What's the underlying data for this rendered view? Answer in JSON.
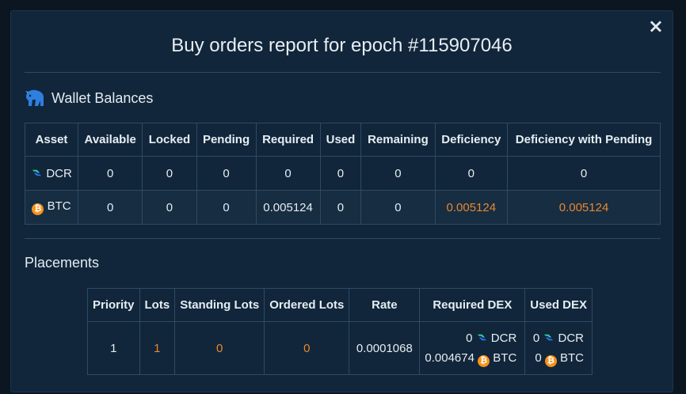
{
  "modal": {
    "title": "Buy orders report for epoch #115907046",
    "close_glyph": "×"
  },
  "wallet_balances": {
    "heading": "Wallet Balances",
    "icon": "dex-bull-logo-icon",
    "columns": [
      "Asset",
      "Available",
      "Locked",
      "Pending",
      "Required",
      "Used",
      "Remaining",
      "Deficiency",
      "Deficiency with Pending"
    ],
    "rows": [
      {
        "asset": "DCR",
        "icon": "dcr-icon",
        "available": "0",
        "locked": "0",
        "pending": "0",
        "required": "0",
        "used": "0",
        "remaining": "0",
        "deficiency": "0",
        "deficiency_pending": "0"
      },
      {
        "asset": "BTC",
        "icon": "btc-icon",
        "available": "0",
        "locked": "0",
        "pending": "0",
        "required": "0.005124",
        "used": "0",
        "remaining": "0",
        "deficiency": "0.005124",
        "deficiency_pending": "0.005124"
      }
    ]
  },
  "placements": {
    "heading": "Placements",
    "columns": [
      "Priority",
      "Lots",
      "Standing Lots",
      "Ordered Lots",
      "Rate",
      "Required DEX",
      "Used DEX"
    ],
    "rows": [
      {
        "priority": "1",
        "lots": "1",
        "standing_lots": "0",
        "ordered_lots": "0",
        "rate": "0.0001068",
        "required_dex": [
          {
            "amount": "0",
            "asset": "DCR"
          },
          {
            "amount": "0.004674",
            "asset": "BTC"
          }
        ],
        "used_dex": [
          {
            "amount": "0",
            "asset": "DCR"
          },
          {
            "amount": "0",
            "asset": "BTC"
          }
        ]
      }
    ]
  },
  "colors": {
    "accent_orange": "#e8872f",
    "modal_bg": "#11263a",
    "border": "#2f4a63"
  }
}
